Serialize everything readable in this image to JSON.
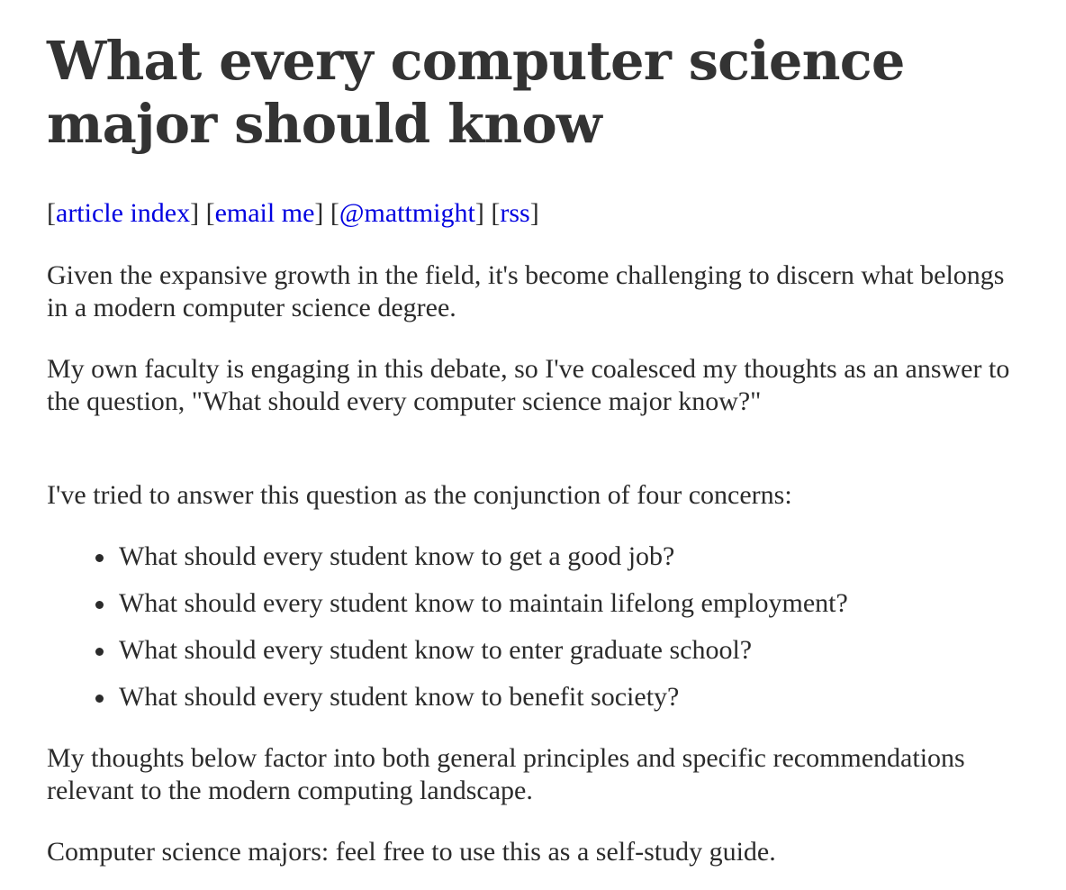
{
  "article": {
    "title": "What every computer science major should know",
    "nav": {
      "open_bracket": "[",
      "close_bracket": "]",
      "links": [
        {
          "label": "article index"
        },
        {
          "label": "email me"
        },
        {
          "label": "@mattmight"
        },
        {
          "label": "rss"
        }
      ]
    },
    "paragraphs": [
      "Given the expansive growth in the field, it's become challenging to discern what belongs in a modern computer science degree.",
      "My own faculty is engaging in this debate, so I've coalesced my thoughts as an answer to the question, \"What should every computer science major know?\"",
      "I've tried to answer this question as the conjunction of four concerns:"
    ],
    "concerns": [
      "What should every student know to get a good job?",
      "What should every student know to maintain lifelong employment?",
      "What should every student know to enter graduate school?",
      "What should every student know to benefit society?"
    ],
    "closing_paragraphs": [
      "My thoughts below factor into both general principles and specific recommendations relevant to the modern computing landscape.",
      "Computer science majors: feel free to use this as a self-study guide."
    ]
  },
  "colors": {
    "text": "#2b2b2b",
    "heading": "#333333",
    "link": "#0000e0",
    "background": "#ffffff"
  }
}
